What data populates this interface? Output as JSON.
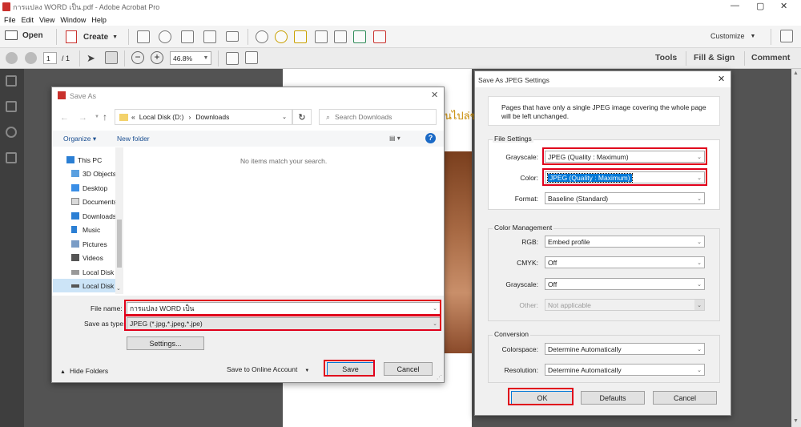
{
  "window": {
    "title": "การแปลง WORD เป็น.pdf - Adobe Acrobat Pro"
  },
  "menu": [
    "File",
    "Edit",
    "View",
    "Window",
    "Help"
  ],
  "toolbar": {
    "open": "Open",
    "create": "Create",
    "customize": "Customize",
    "page_current": "1",
    "page_total": "/ 1",
    "zoom": "46.8%",
    "tools": "Tools",
    "fill_sign": "Fill & Sign",
    "comment": "Comment"
  },
  "document": {
    "visible_text": "นไปล่ช"
  },
  "save_as": {
    "title": "Save As",
    "path": [
      "«",
      "Local Disk (D:)",
      "›",
      "Downloads"
    ],
    "search_placeholder": "Search Downloads",
    "organize": "Organize",
    "new_folder": "New folder",
    "empty_message": "No items match your search.",
    "nav_items": [
      "This PC",
      "3D Objects",
      "Desktop",
      "Documents",
      "Downloads",
      "Music",
      "Pictures",
      "Videos",
      "Local Disk",
      "Local Disk"
    ],
    "file_name_label": "File name:",
    "file_name_value": "การแปลง WORD เป็น",
    "save_type_label": "Save as type:",
    "save_type_value": "JPEG (*.jpg,*.jpeg,*.jpe)",
    "settings_button": "Settings...",
    "hide_folders": "Hide Folders",
    "online_account": "Save to Online Account",
    "save_button": "Save",
    "cancel_button": "Cancel"
  },
  "jpeg_settings": {
    "title": "Save As JPEG Settings",
    "note": "Pages that have only a single JPEG image covering the whole page will be left unchanged.",
    "file_settings": {
      "legend": "File Settings",
      "grayscale_label": "Grayscale:",
      "grayscale_value": "JPEG (Quality : Maximum)",
      "color_label": "Color:",
      "color_value": "JPEG (Quality : Maximum)",
      "format_label": "Format:",
      "format_value": "Baseline (Standard)"
    },
    "color_mgmt": {
      "legend": "Color Management",
      "rgb_label": "RGB:",
      "rgb_value": "Embed profile",
      "cmyk_label": "CMYK:",
      "cmyk_value": "Off",
      "grayscale_label": "Grayscale:",
      "grayscale_value": "Off",
      "other_label": "Other:",
      "other_value": "Not applicable"
    },
    "conversion": {
      "legend": "Conversion",
      "colorspace_label": "Colorspace:",
      "colorspace_value": "Determine Automatically",
      "resolution_label": "Resolution:",
      "resolution_value": "Determine Automatically"
    },
    "ok": "OK",
    "defaults": "Defaults",
    "cancel": "Cancel"
  },
  "colors": {
    "highlight": "#e0001b",
    "selection": "#0078d7",
    "accent_blue": "#1b6ac6"
  }
}
